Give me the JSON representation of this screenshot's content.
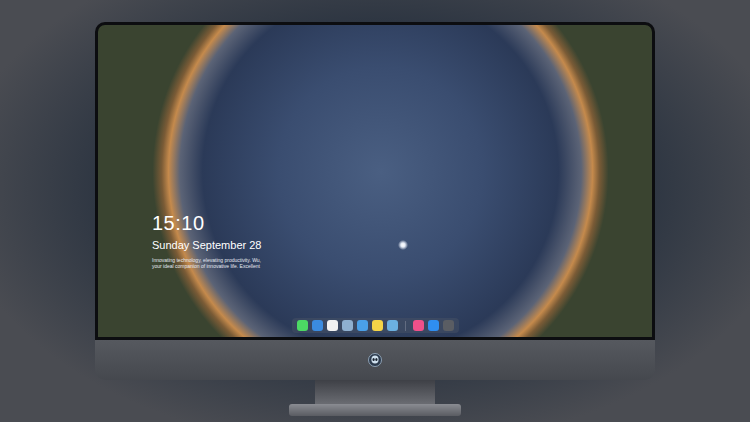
{
  "screen": {
    "clock": {
      "time": "15:10",
      "date": "Sunday September 28",
      "tagline": [
        "Innovating technology, elevating productivity. Wu,",
        "your ideal companion of innovative life. Excellent"
      ]
    },
    "dock": [
      {
        "kind": "app",
        "color": "#4cd964"
      },
      {
        "kind": "app",
        "color": "#3b8be0"
      },
      {
        "kind": "app",
        "color": "#f2f2f2"
      },
      {
        "kind": "app",
        "color": "#8fb0d0"
      },
      {
        "kind": "app",
        "color": "#4aa0e8"
      },
      {
        "kind": "app",
        "color": "#f5d547"
      },
      {
        "kind": "app",
        "color": "#6bb0e0"
      },
      {
        "kind": "separator",
        "color": "#8a90a0"
      },
      {
        "kind": "app",
        "color": "#f0508a"
      },
      {
        "kind": "app",
        "color": "#2f8ef0"
      },
      {
        "kind": "app",
        "color": "#5a5d63"
      }
    ]
  }
}
